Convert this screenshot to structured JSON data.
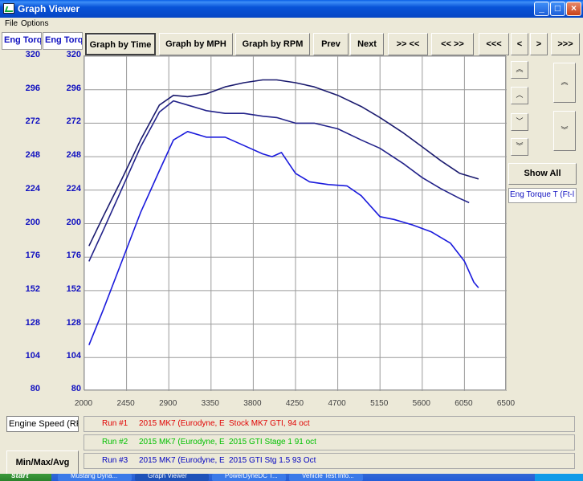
{
  "window": {
    "title": "Graph Viewer"
  },
  "menu": {
    "file": "File",
    "options": "Options"
  },
  "toolbar": {
    "graph_by_time": "Graph by Time",
    "graph_by_mph": "Graph by MPH",
    "graph_by_rpm": "Graph by RPM",
    "prev": "Prev",
    "next": "Next",
    "zoom_in": ">> <<",
    "zoom_out": "<< >>",
    "first": "<<<",
    "back": "<",
    "forward": ">",
    "last": ">>>"
  },
  "axis_tabs": {
    "left1": "Eng Torque",
    "left2": "Eng Torque"
  },
  "right_panel": {
    "show_all": "Show All",
    "channel": "Eng Torque T (Ft-l",
    "scroll_up_fast": "⌃⌃",
    "scroll_up": "⌃",
    "scroll_down": "⌄",
    "scroll_down_fast": "⌄⌄"
  },
  "x_channel": "Engine Speed (RPI",
  "min_max_button": "Min/Max/Avg",
  "runs": [
    {
      "run": "Run #1",
      "vehicle": "2015 MK7 (Eurodyne, E",
      "description": "Stock MK7 GTI, 94 oct",
      "color": "#e00000"
    },
    {
      "run": "Run #2",
      "vehicle": "2015 MK7 (Eurodyne, E",
      "description": "2015 GTI Stage 1 91 oct",
      "color": "#00c000"
    },
    {
      "run": "Run #3",
      "vehicle": "2015 MK7 (Eurodyne, E",
      "description": "2015 GTI Stg 1.5 93 Oct",
      "color": "#0000c0"
    }
  ],
  "taskbar": {
    "start": "start",
    "tasks": [
      "Mustang Dyna...",
      "Graph Viewer",
      "PowerDyneDC T...",
      "Vehicle Test Info..."
    ]
  },
  "chart_data": {
    "type": "line",
    "xlim": [
      2000,
      6500
    ],
    "ylim": [
      80,
      320
    ],
    "x_ticks": [
      2000,
      2450,
      2900,
      3350,
      3800,
      4250,
      4700,
      5150,
      5600,
      6050,
      6500
    ],
    "y_ticks": [
      80,
      104,
      128,
      152,
      176,
      200,
      224,
      248,
      272,
      296,
      320
    ],
    "grid": true,
    "series": [
      {
        "color": "#1a1a6e",
        "x": [
          2050,
          2200,
          2400,
          2600,
          2800,
          2950,
          3100,
          3300,
          3500,
          3700,
          3900,
          4050,
          4250,
          4450,
          4700,
          4950,
          5150,
          5400,
          5600,
          5800,
          6000,
          6200
        ],
        "y": [
          184,
          205,
          232,
          260,
          285,
          292,
          291,
          293,
          298,
          301,
          303,
          303,
          301,
          298,
          292,
          284,
          276,
          265,
          255,
          245,
          236,
          232
        ]
      },
      {
        "color": "#22228a",
        "x": [
          2050,
          2200,
          2400,
          2600,
          2800,
          2950,
          3100,
          3300,
          3500,
          3700,
          3900,
          4050,
          4250,
          4450,
          4700,
          4950,
          5150,
          5400,
          5600,
          5800,
          6000,
          6100
        ],
        "y": [
          173,
          195,
          225,
          255,
          280,
          288,
          285,
          281,
          279,
          279,
          277,
          276,
          272,
          272,
          268,
          260,
          254,
          243,
          233,
          225,
          218,
          215
        ]
      },
      {
        "color": "#1a1adc",
        "x": [
          2050,
          2200,
          2400,
          2600,
          2800,
          2950,
          3100,
          3300,
          3500,
          3700,
          3900,
          4000,
          4100,
          4250,
          4400,
          4600,
          4800,
          4950,
          5150,
          5300,
          5500,
          5700,
          5900,
          6050,
          6150,
          6200
        ],
        "y": [
          113,
          138,
          173,
          208,
          238,
          260,
          266,
          262,
          262,
          256,
          250,
          248,
          251,
          236,
          230,
          228,
          227,
          220,
          205,
          203,
          199,
          194,
          186,
          173,
          158,
          154
        ]
      }
    ]
  }
}
